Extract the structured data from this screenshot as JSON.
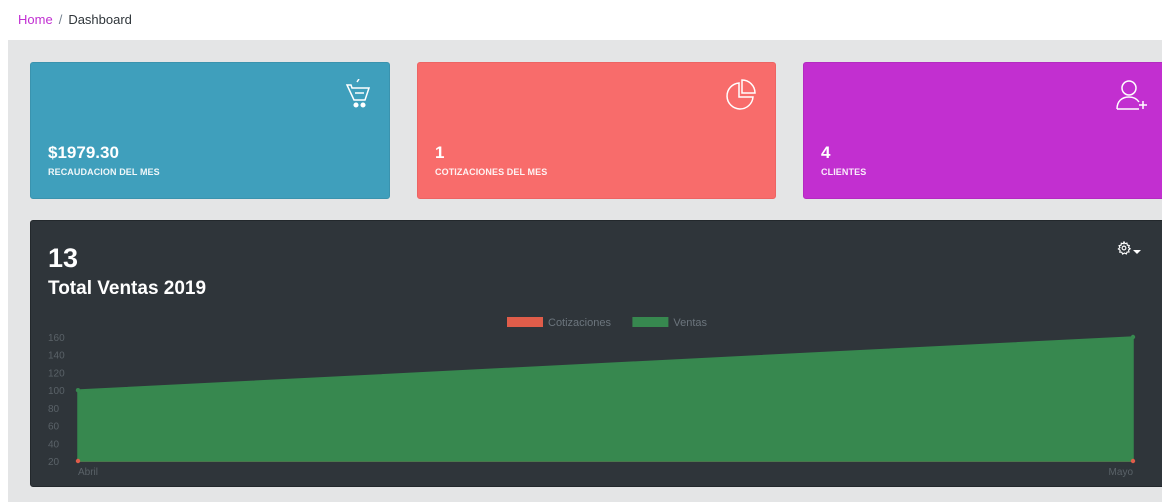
{
  "breadcrumb": {
    "home": "Home",
    "separator": "/",
    "current": "Dashboard"
  },
  "cards": [
    {
      "value": "$1979.30",
      "label": "RECAUDACION DEL MES",
      "icon": "basket-icon",
      "color": "#3f9fbc"
    },
    {
      "value": "1",
      "label": "COTIZACIONES DEL MES",
      "icon": "pie-chart-icon",
      "color": "#f86c6b"
    },
    {
      "value": "4",
      "label": "CLIENTES",
      "icon": "user-add-icon",
      "color": "#c22fd0"
    }
  ],
  "sales": {
    "count": "13",
    "title": "Total Ventas 2019",
    "settings_icon": "gear-icon"
  },
  "chart_data": {
    "type": "area",
    "categories": [
      "Abril",
      "Mayo"
    ],
    "series": [
      {
        "name": "Cotizaciones",
        "values": [
          0,
          0
        ],
        "color": "#e05d4a"
      },
      {
        "name": "Ventas",
        "values": [
          100,
          160
        ],
        "color": "#37884f"
      }
    ],
    "yticks": [
      20,
      40,
      60,
      80,
      100,
      120,
      140,
      160
    ],
    "ylim": [
      20,
      160
    ],
    "grid": false,
    "legend": "top-center"
  }
}
